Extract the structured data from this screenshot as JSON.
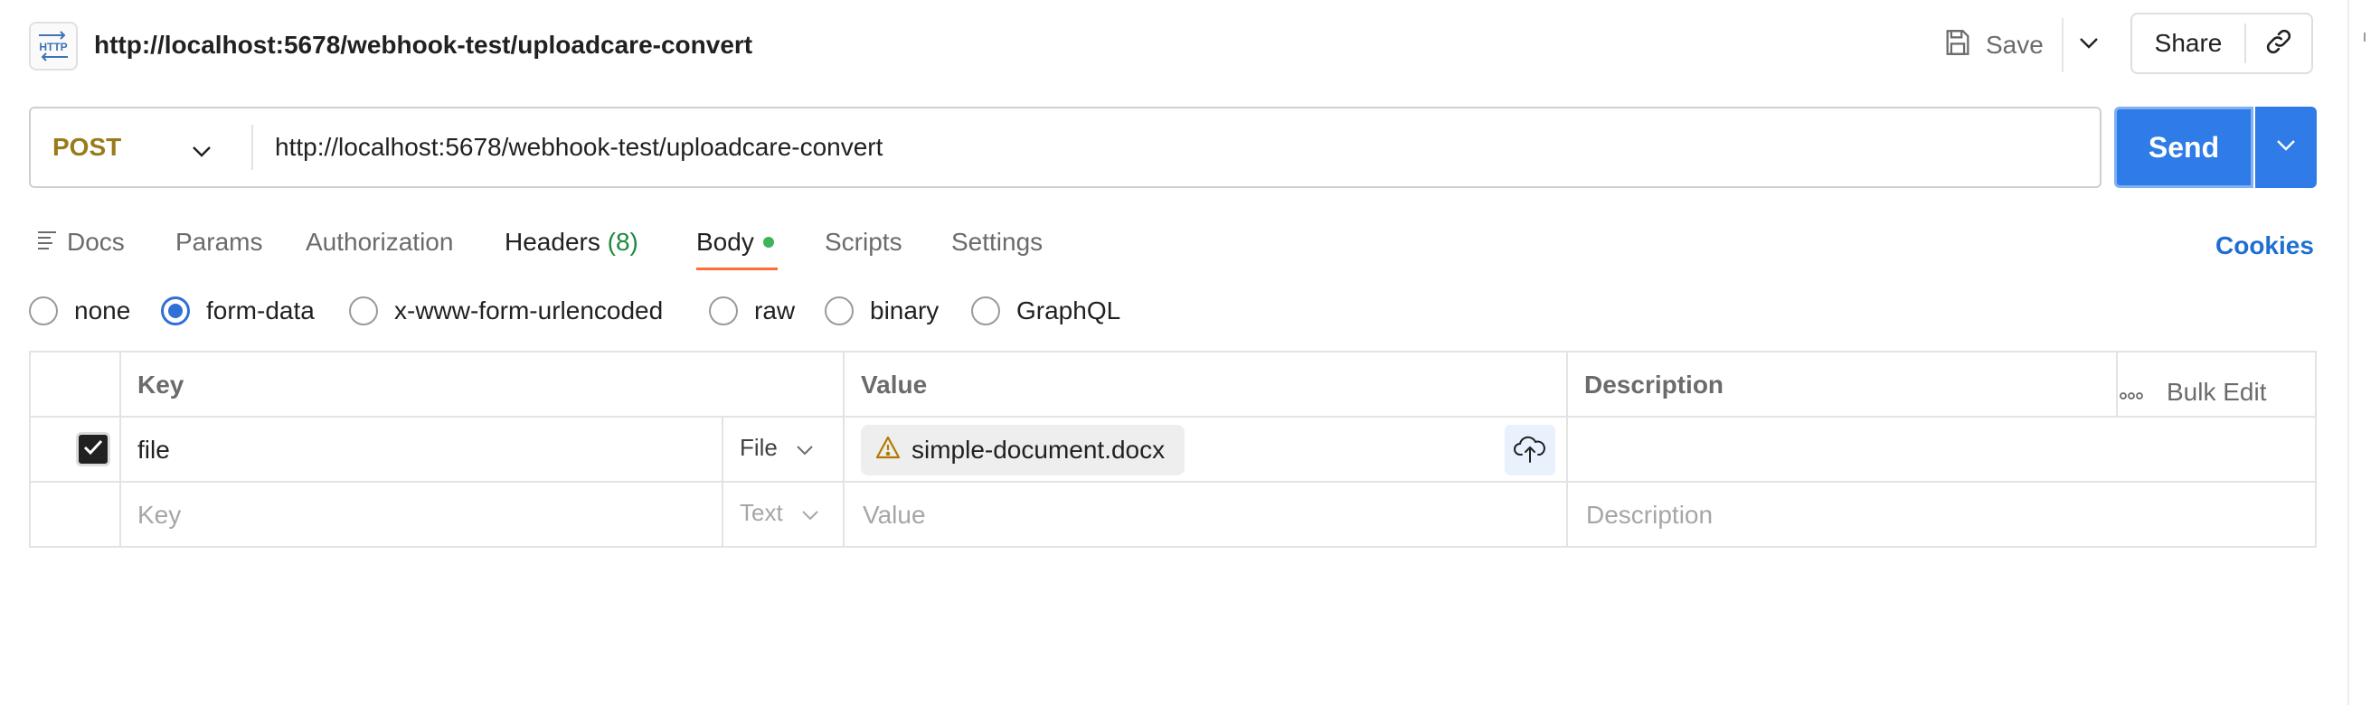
{
  "header": {
    "title": "http://localhost:5678/webhook-test/uploadcare-convert",
    "icon_text": "HTTP",
    "save_label": "Save",
    "share_label": "Share"
  },
  "request": {
    "method": "POST",
    "url": "http://localhost:5678/webhook-test/uploadcare-convert",
    "send_label": "Send"
  },
  "tabs": {
    "docs": "Docs",
    "params": "Params",
    "authorization": "Authorization",
    "headers": "Headers",
    "headers_count": "(8)",
    "body": "Body",
    "scripts": "Scripts",
    "settings": "Settings",
    "cookies": "Cookies",
    "active": "Body"
  },
  "body_types": {
    "options": [
      "none",
      "form-data",
      "x-www-form-urlencoded",
      "raw",
      "binary",
      "GraphQL"
    ],
    "selected": "form-data"
  },
  "table": {
    "headers": {
      "key": "Key",
      "value": "Value",
      "description": "Description",
      "bulk_edit": "Bulk Edit"
    },
    "rows": [
      {
        "checked": true,
        "key": "file",
        "type": "File",
        "value": "simple-document.docx",
        "description": ""
      }
    ],
    "new_row": {
      "key_placeholder": "Key",
      "type": "Text",
      "value_placeholder": "Value",
      "description_placeholder": "Description"
    }
  },
  "colors": {
    "method": "#9a7b1c",
    "send": "#2f7be7",
    "cookies": "#1f6fd1",
    "tab_underline": "#ff6c37",
    "body_dot": "#3fb35a",
    "radio_selected": "#2f6fd6",
    "headers_count": "#1f8a3d"
  },
  "icons": {
    "request": "http-request-icon",
    "save": "floppy-disk-icon",
    "link": "link-icon",
    "docs": "lines-icon",
    "warning": "warning-triangle-icon",
    "upload": "cloud-upload-icon",
    "more": "ellipsis-icon"
  }
}
